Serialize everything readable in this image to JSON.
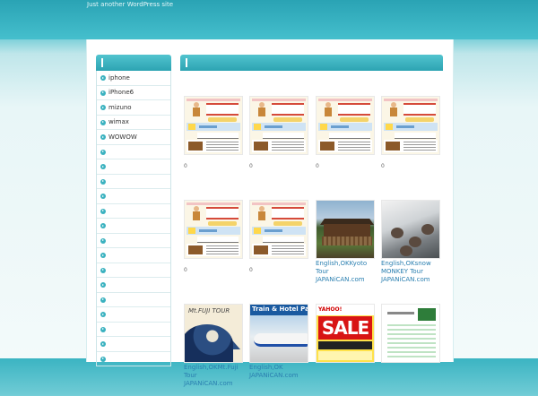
{
  "header": {
    "tagline": "Just another WordPress site"
  },
  "sidebar": {
    "widget_title": "",
    "items": [
      {
        "label": "iphone"
      },
      {
        "label": "iPhone6"
      },
      {
        "label": "mizuno"
      },
      {
        "label": "wimax"
      },
      {
        "label": "WOWOW"
      },
      {
        "label": ""
      },
      {
        "label": ""
      },
      {
        "label": ""
      },
      {
        "label": ""
      },
      {
        "label": ""
      },
      {
        "label": ""
      },
      {
        "label": ""
      },
      {
        "label": ""
      },
      {
        "label": ""
      },
      {
        "label": ""
      },
      {
        "label": ""
      },
      {
        "label": ""
      },
      {
        "label": ""
      },
      {
        "label": ""
      },
      {
        "label": ""
      }
    ]
  },
  "main": {
    "title": "",
    "cards": [
      {
        "thumb": "flyer-image",
        "caption": "",
        "meta": "0"
      },
      {
        "thumb": "flyer-image",
        "caption": "",
        "meta": "0"
      },
      {
        "thumb": "flyer-image",
        "caption": "",
        "meta": "0"
      },
      {
        "thumb": "flyer-image",
        "caption": "",
        "meta": "0"
      },
      {
        "thumb": "flyer-image",
        "caption": "",
        "meta": "0"
      },
      {
        "thumb": "flyer-image",
        "caption": "",
        "meta": "0"
      },
      {
        "thumb": "kyoto-temple-photo",
        "caption": "English,OKKyoto Tour JAPANiCAN.com",
        "meta": ""
      },
      {
        "thumb": "snow-monkey-photo",
        "caption": "English,OKsnow MONKEY Tour JAPANiCAN.com",
        "meta": ""
      },
      {
        "thumb": "fuji-wave-image",
        "caption": "English,OKMt.Fuji Tour JAPANiCAN.com",
        "meta": "",
        "image_text": "Mt.FUJI TOUR"
      },
      {
        "thumb": "train-hotel-image",
        "caption": "English,OK JAPANiCAN.com",
        "meta": "",
        "image_text": "Train & Hotel Pac"
      },
      {
        "thumb": "sale-banner-image",
        "caption": "",
        "meta": "",
        "image_text": "SALE",
        "image_text_top": "YAHOO!"
      },
      {
        "thumb": "screenshot-image",
        "caption": "",
        "meta": ""
      }
    ]
  }
}
